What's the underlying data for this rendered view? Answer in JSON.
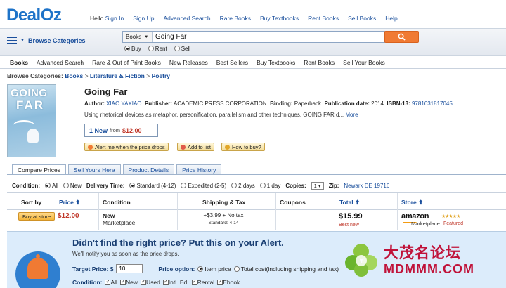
{
  "logo": {
    "deal": "Deal",
    "oz": "Oz"
  },
  "topnav": {
    "hello": "Hello",
    "items": [
      "Sign In",
      "Sign Up",
      "Advanced Search",
      "Rare Books",
      "Buy Textbooks",
      "Rent Books",
      "Sell Books",
      "Help"
    ]
  },
  "search": {
    "browse_label": "Browse Categories",
    "category": "Books",
    "query": "Going Far",
    "options": [
      "Buy",
      "Rent",
      "Sell"
    ],
    "selected_option": "Buy"
  },
  "subnav": [
    "Books",
    "Advanced Search",
    "Rare & Out of Print Books",
    "New Releases",
    "Best Sellers",
    "Buy Textbooks",
    "Rent Books",
    "Sell Your Books"
  ],
  "breadcrumb": {
    "label": "Browse Categories:",
    "items": [
      "Books",
      "Literature & Fiction",
      "Poetry"
    ],
    "sep": ">"
  },
  "cover": {
    "title_line1": "GOING",
    "title_line2": "FAR"
  },
  "book": {
    "title": "Going Far",
    "author_label": "Author:",
    "author": "XIAO YAXIAO",
    "publisher_label": "Publisher:",
    "publisher": "ACADEMIC PRESS CORPORATION",
    "binding_label": "Binding:",
    "binding": "Paperback",
    "pubdate_label": "Publication date:",
    "pubdate": "2014",
    "isbn_label": "ISBN-13:",
    "isbn": "9781631817045",
    "description": "Using rhetorical devices as metaphor, personification, parallelism and other techniques, GOING FAR d...",
    "more": "More",
    "new_count": "1 New",
    "from": "from",
    "from_price": "$12.00"
  },
  "actions": [
    "Alert me when the price drops",
    "Add to list",
    "How to buy?"
  ],
  "tabs": [
    "Compare Prices",
    "Sell Yours Here",
    "Product Details",
    "Price History"
  ],
  "filters": {
    "condition_label": "Condition:",
    "conditions": [
      "All",
      "New"
    ],
    "delivery_label": "Delivery Time:",
    "deliveries": [
      "Standard (4-12)",
      "Expedited (2-5)",
      "2 days",
      "1 day"
    ],
    "copies_label": "Copies:",
    "copies": "1",
    "zip_label": "Zip:",
    "zip": "Newark DE  19716"
  },
  "table": {
    "headers": [
      "Sort by",
      "Price",
      "Condition",
      "Shipping & Tax",
      "Coupons",
      "Total",
      "Store"
    ],
    "row": {
      "buy": "Buy at store",
      "price": "$12.00",
      "condition": "New",
      "condition_sub": "Marketplace",
      "shipping": "+$3.99 + No tax",
      "shipping_sub": "Standard: 4-14",
      "total": "$15.99",
      "total_note": "Best new",
      "store": "amazon",
      "store_sub": "Marketplace",
      "rating": "★★★★★",
      "store_note": "Featured"
    }
  },
  "alert": {
    "heading": "Didn't find the right price? Put this on your Alert.",
    "sub": "We'll notify you as soon as the price drops.",
    "target_label": "Target Price: $",
    "target_value": "10",
    "option_label": "Price option:",
    "options": [
      "Item price",
      "Total cost(including shipping and tax)"
    ],
    "condition_label": "Condition:",
    "conditions": [
      "All",
      "New",
      "Used",
      "Intl. Ed.",
      "Rental",
      "Ebook"
    ]
  },
  "watermark": {
    "line1": "大茂名论坛",
    "line2": "MDMMM.COM"
  },
  "colors": {
    "brand": "#1e73c8",
    "link": "#1a4f9c",
    "price": "#c0392b",
    "search_button": "#f07a33",
    "alert_bg": "#dcecfb"
  }
}
